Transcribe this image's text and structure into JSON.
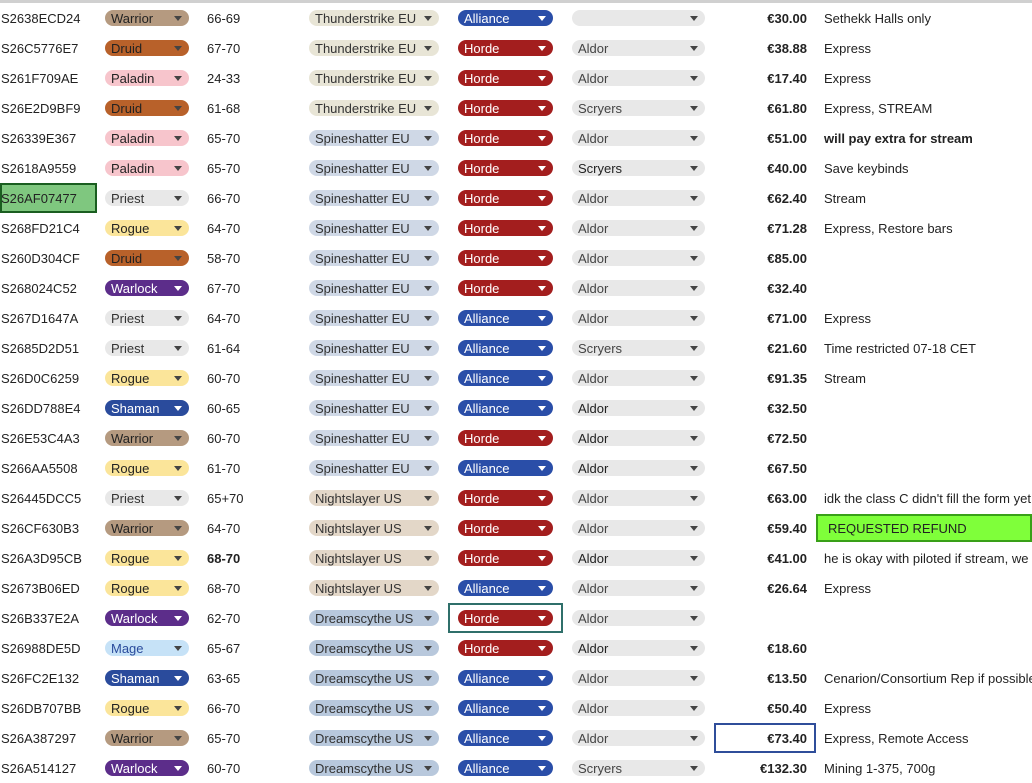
{
  "colors": {
    "class": {
      "Warrior": {
        "bg": "#b59a80",
        "fg": "#222222",
        "tone": "light"
      },
      "Druid": {
        "bg": "#b8612a",
        "fg": "#222222",
        "tone": "light"
      },
      "Paladin": {
        "bg": "#f7c5cc",
        "fg": "#222222",
        "tone": "light"
      },
      "Priest": {
        "bg": "#e8e8e8",
        "fg": "#333333",
        "tone": "light"
      },
      "Rogue": {
        "bg": "#fbe59a",
        "fg": "#222222",
        "tone": "light"
      },
      "Warlock": {
        "bg": "#5c2d8a",
        "fg": "#ffffff",
        "tone": "dark"
      },
      "Shaman": {
        "bg": "#2a4b9c",
        "fg": "#ffffff",
        "tone": "dark"
      },
      "Mage": {
        "bg": "#c6e2f7",
        "fg": "#2a4b9c",
        "tone": "light"
      }
    },
    "server": {
      "Thunderstrike EU": {
        "bg": "#e8e5d6",
        "fg": "#333333"
      },
      "Spineshatter EU": {
        "bg": "#cfd8e6",
        "fg": "#333333"
      },
      "Nightslayer US": {
        "bg": "#e3d7c8",
        "fg": "#333333"
      },
      "Dreamscythe US": {
        "bg": "#b8c8dc",
        "fg": "#333333"
      }
    },
    "faction": {
      "Alliance": {
        "bg": "#2a4ea8",
        "fg": "#ffffff"
      },
      "Horde": {
        "bg": "#a31e1e",
        "fg": "#ffffff"
      }
    }
  },
  "rows": [
    {
      "id": "S2638ECD24",
      "class": "Warrior",
      "level": "66-69",
      "server": "Thunderstrike EU",
      "faction": "Alliance",
      "rep": "",
      "price": "€30.00",
      "note": "Sethekk Halls only"
    },
    {
      "id": "S26C5776E7",
      "class": "Druid",
      "level": "67-70",
      "server": "Thunderstrike EU",
      "faction": "Horde",
      "rep": "Aldor",
      "price": "€38.88",
      "note": "Express"
    },
    {
      "id": "S261F709AE",
      "class": "Paladin",
      "level": "24-33",
      "server": "Thunderstrike EU",
      "faction": "Horde",
      "rep": "Aldor",
      "price": "€17.40",
      "note": "Express"
    },
    {
      "id": "S26E2D9BF9",
      "class": "Druid",
      "level": "61-68",
      "server": "Thunderstrike EU",
      "faction": "Horde",
      "rep": "Scryers",
      "price": "€61.80",
      "note": "Express, STREAM"
    },
    {
      "id": "S26339E367",
      "class": "Paladin",
      "level": "65-70",
      "server": "Spineshatter EU",
      "faction": "Horde",
      "rep": "Aldor",
      "price": "€51.00",
      "note": "will pay extra for stream",
      "noteBold": true
    },
    {
      "id": "S2618A9559",
      "class": "Paladin",
      "level": "65-70",
      "server": "Spineshatter EU",
      "faction": "Horde",
      "rep": "Scryers",
      "price": "€40.00",
      "note": "Save keybinds",
      "repDark": true
    },
    {
      "id": "S26AF07477",
      "class": "Priest",
      "level": "66-70",
      "server": "Spineshatter EU",
      "faction": "Horde",
      "rep": "Aldor",
      "price": "€62.40",
      "note": "Stream",
      "selectedId": true
    },
    {
      "id": "S268FD21C4",
      "class": "Rogue",
      "level": "64-70",
      "server": "Spineshatter EU",
      "faction": "Horde",
      "rep": "Aldor",
      "price": "€71.28",
      "note": "Express, Restore bars"
    },
    {
      "id": "S260D304CF",
      "class": "Druid",
      "level": "58-70",
      "server": "Spineshatter EU",
      "faction": "Horde",
      "rep": "Aldor",
      "price": "€85.00",
      "note": ""
    },
    {
      "id": "S268024C52",
      "class": "Warlock",
      "level": "67-70",
      "server": "Spineshatter EU",
      "faction": "Horde",
      "rep": "Aldor",
      "price": "€32.40",
      "note": ""
    },
    {
      "id": "S267D1647A",
      "class": "Priest",
      "level": "64-70",
      "server": "Spineshatter EU",
      "faction": "Alliance",
      "rep": "Aldor",
      "price": "€71.00",
      "note": "Express"
    },
    {
      "id": "S2685D2D51",
      "class": "Priest",
      "level": "61-64",
      "server": "Spineshatter EU",
      "faction": "Alliance",
      "rep": "Scryers",
      "price": "€21.60",
      "note": "Time restricted 07-18 CET"
    },
    {
      "id": "S26D0C6259",
      "class": "Rogue",
      "level": "60-70",
      "server": "Spineshatter EU",
      "faction": "Alliance",
      "rep": "Aldor",
      "price": "€91.35",
      "note": "Stream"
    },
    {
      "id": "S26DD788E4",
      "class": "Shaman",
      "level": "60-65",
      "server": "Spineshatter EU",
      "faction": "Alliance",
      "rep": "Aldor",
      "price": "€32.50",
      "note": "",
      "repDark": true
    },
    {
      "id": "S26E53C4A3",
      "class": "Warrior",
      "level": "60-70",
      "server": "Spineshatter EU",
      "faction": "Horde",
      "rep": "Aldor",
      "price": "€72.50",
      "note": "",
      "repDark": true
    },
    {
      "id": "S266AA5508",
      "class": "Rogue",
      "level": "61-70",
      "server": "Spineshatter EU",
      "faction": "Alliance",
      "rep": "Aldor",
      "price": "€67.50",
      "note": "",
      "repDark": true
    },
    {
      "id": "S26445DCC5",
      "class": "Priest",
      "level": "65+70",
      "server": "Nightslayer US",
      "faction": "Horde",
      "rep": "Aldor",
      "price": "€63.00",
      "note": "idk the class C didn't fill the form yet"
    },
    {
      "id": "S26CF630B3",
      "class": "Warrior",
      "level": "64-70",
      "server": "Nightslayer US",
      "faction": "Horde",
      "rep": "Aldor",
      "price": "€59.40",
      "note": "REQUESTED REFUND",
      "refund": true
    },
    {
      "id": "S26A3D95CB",
      "class": "Rogue",
      "level": "68-70",
      "server": "Nightslayer US",
      "faction": "Horde",
      "rep": "Aldor",
      "price": "€41.00",
      "note": "he is okay with piloted if stream, we",
      "levelBold": true,
      "repDark": true
    },
    {
      "id": "S2673B06ED",
      "class": "Rogue",
      "level": "68-70",
      "server": "Nightslayer US",
      "faction": "Alliance",
      "rep": "Aldor",
      "price": "€26.64",
      "note": "Express"
    },
    {
      "id": "S26B337E2A",
      "class": "Warlock",
      "level": "62-70",
      "server": "Dreamscythe US",
      "faction": "Horde",
      "rep": "Aldor",
      "price": "",
      "note": "",
      "selectedFaction": true
    },
    {
      "id": "S26988DE5D",
      "class": "Mage",
      "level": "65-67",
      "server": "Dreamscythe US",
      "faction": "Horde",
      "rep": "Aldor",
      "price": "€18.60",
      "note": "",
      "repDark": true
    },
    {
      "id": "S26FC2E132",
      "class": "Shaman",
      "level": "63-65",
      "server": "Dreamscythe US",
      "faction": "Alliance",
      "rep": "Aldor",
      "price": "€13.50",
      "note": "Cenarion/Consortium Rep if possible"
    },
    {
      "id": "S26DB707BB",
      "class": "Rogue",
      "level": "66-70",
      "server": "Dreamscythe US",
      "faction": "Alliance",
      "rep": "Aldor",
      "price": "€50.40",
      "note": "Express"
    },
    {
      "id": "S26A387297",
      "class": "Warrior",
      "level": "65-70",
      "server": "Dreamscythe US",
      "faction": "Alliance",
      "rep": "Aldor",
      "price": "€73.40",
      "note": "Express, Remote Access",
      "selectedPrice": true
    },
    {
      "id": "S26A514127",
      "class": "Warlock",
      "level": "60-70",
      "server": "Dreamscythe US",
      "faction": "Alliance",
      "rep": "Scryers",
      "price": "€132.30",
      "note": "Mining 1-375, 700g"
    }
  ]
}
